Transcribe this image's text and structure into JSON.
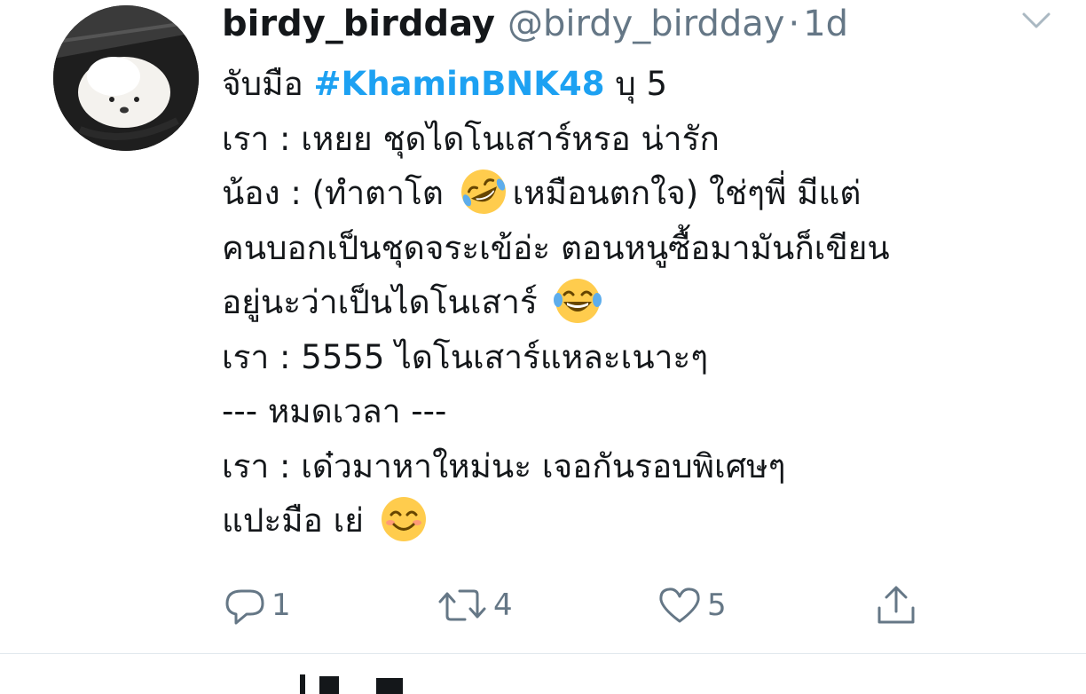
{
  "tweet": {
    "display_name": "birdy_birdday",
    "handle": "@birdy_birdday",
    "separator": "·",
    "time": "1d",
    "lines": [
      {
        "before": "จับมือ ",
        "hashtag": "#KhaminBNK48",
        "after": " บุ 5"
      },
      {
        "text": "เรา : เหยย ชุดไดโนเสาร์หรอ น่ารัก"
      },
      {
        "before": "น้อง : (ทำตาโต ",
        "emoji": "rofl-emoji",
        "after": "เหมือนตกใจ) ใช่ๆพี่ มีแต่"
      },
      {
        "text": "คนบอกเป็นชุดจระเข้อ่ะ ตอนหนูซื้อมามันก็เขียน"
      },
      {
        "before": "อยู่นะว่าเป็นไดโนเสาร์ ",
        "emoji": "joy-emoji",
        "after": ""
      },
      {
        "text": "เรา : 5555 ไดโนเสาร์แหละเนาะๆ"
      },
      {
        "text": "--- หมดเวลา ---"
      },
      {
        "text": "เรา : เด๋วมาหาใหม่นะ เจอกันรอบพิเศษๆ"
      },
      {
        "before": "แปะมือ เย่ ",
        "emoji": "smile-emoji",
        "after": ""
      }
    ],
    "hashtag_color": "#1da1f2"
  },
  "actions": {
    "reply": {
      "icon": "reply-icon",
      "count": "1"
    },
    "retweet": {
      "icon": "retweet-icon",
      "count": "4"
    },
    "like": {
      "icon": "heart-icon",
      "count": "5"
    },
    "share": {
      "icon": "share-icon"
    }
  },
  "colors": {
    "text": "#14171a",
    "secondary": "#657786",
    "divider": "#e1e8ed"
  }
}
